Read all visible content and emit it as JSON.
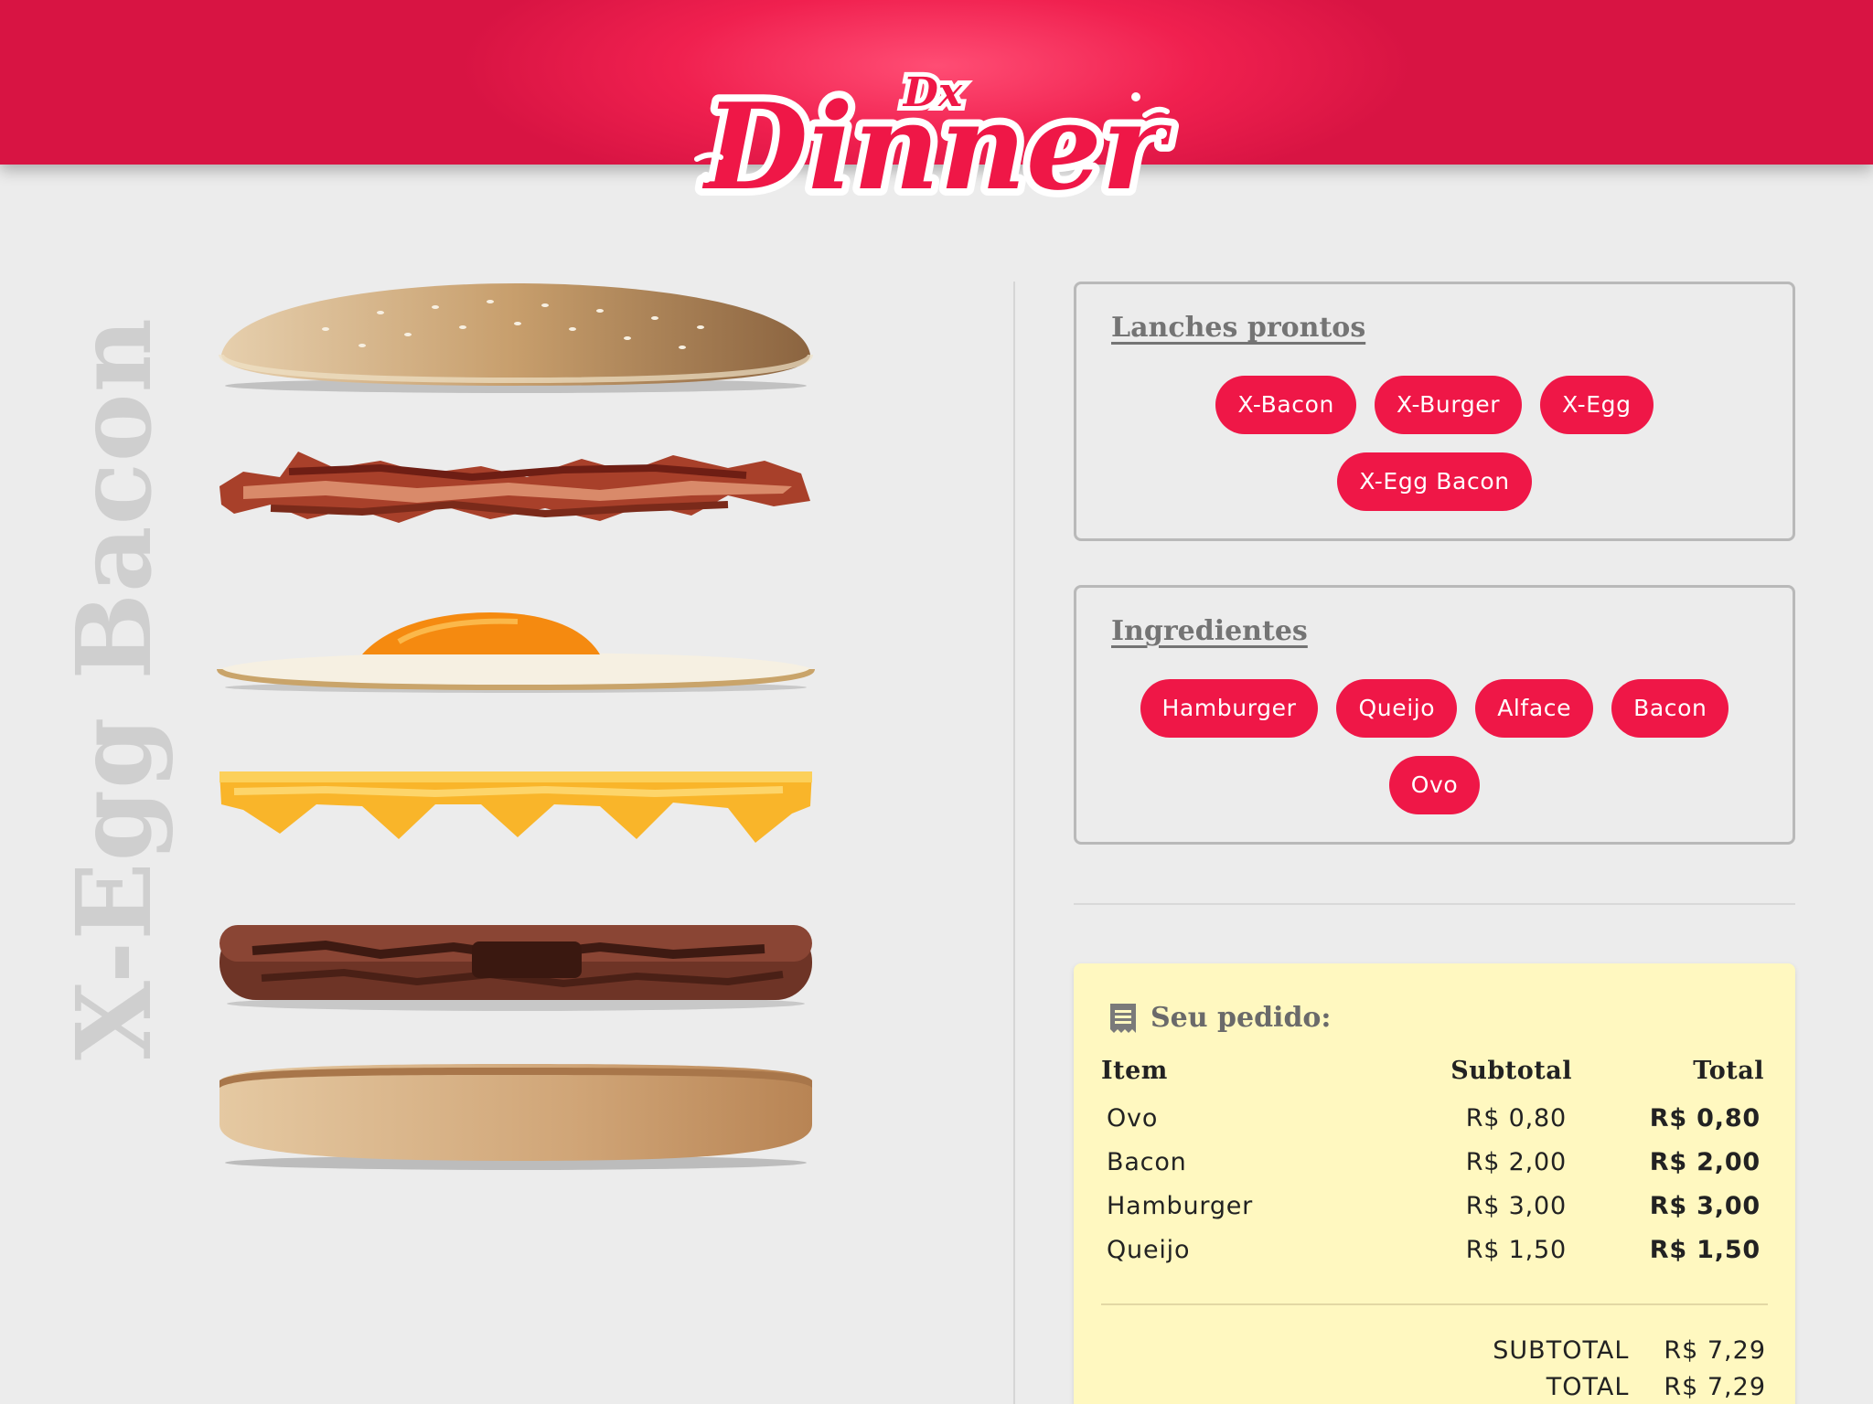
{
  "brand": {
    "logo_small": "Dx",
    "logo_main": "Dinner",
    "primary_color": "#ef1747"
  },
  "product_title": "X-Egg Bacon",
  "burger_layers": [
    "top-bun",
    "bacon",
    "egg",
    "cheese",
    "patty",
    "bottom-bun"
  ],
  "ready_section": {
    "title": "Lanches prontos",
    "items": [
      "X-Bacon",
      "X-Burger",
      "X-Egg",
      "X-Egg Bacon"
    ]
  },
  "ingredients_section": {
    "title": "Ingredientes",
    "items": [
      "Hamburger",
      "Queijo",
      "Alface",
      "Bacon",
      "Ovo"
    ]
  },
  "order": {
    "title": "Seu pedido:",
    "icon": "receipt-icon",
    "headers": {
      "item": "Item",
      "subtotal": "Subtotal",
      "total": "Total"
    },
    "rows": [
      {
        "item": "Ovo",
        "subtotal": "R$ 0,80",
        "total": "R$ 0,80"
      },
      {
        "item": "Bacon",
        "subtotal": "R$ 2,00",
        "total": "R$ 2,00"
      },
      {
        "item": "Hamburger",
        "subtotal": "R$ 3,00",
        "total": "R$ 3,00"
      },
      {
        "item": "Queijo",
        "subtotal": "R$ 1,50",
        "total": "R$ 1,50"
      }
    ],
    "summary": {
      "subtotal_label": "SUBTOTAL",
      "subtotal_value": "R$ 7,29",
      "total_label": "TOTAL",
      "total_value": "R$ 7,29"
    }
  }
}
